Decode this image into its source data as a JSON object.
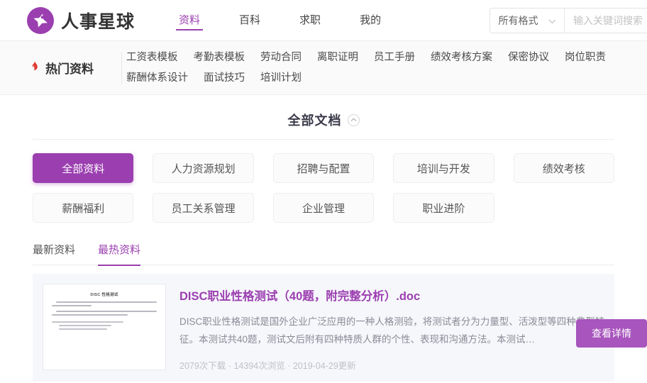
{
  "brand": {
    "name": "人事星球",
    "logo_icon": "star-planet-logo-icon",
    "logo_color": "#9b3fb0"
  },
  "nav": {
    "items": [
      {
        "label": "资料",
        "active": true
      },
      {
        "label": "百科",
        "active": false
      },
      {
        "label": "求职",
        "active": false
      },
      {
        "label": "我的",
        "active": false
      }
    ]
  },
  "search": {
    "format_label": "所有格式",
    "format_icon": "chevron-down-icon",
    "placeholder": "输入关键词搜索",
    "value": ""
  },
  "hot_section": {
    "label": "热门资料",
    "icon": "flame-icon",
    "icon_color": "#e03a2f",
    "tags": [
      "工资表模板",
      "考勤表模板",
      "劳动合同",
      "离职证明",
      "员工手册",
      "绩效考核方案",
      "保密协议",
      "岗位职责",
      "薪酬体系设计",
      "面试技巧",
      "培训计划"
    ]
  },
  "all_docs": {
    "title": "全部文档",
    "collapse_icon": "chevron-up-icon"
  },
  "categories": [
    {
      "label": "全部资料",
      "active": true
    },
    {
      "label": "人力资源规划",
      "active": false
    },
    {
      "label": "招聘与配置",
      "active": false
    },
    {
      "label": "培训与开发",
      "active": false
    },
    {
      "label": "绩效考核",
      "active": false
    },
    {
      "label": "薪酬福利",
      "active": false
    },
    {
      "label": "员工关系管理",
      "active": false
    },
    {
      "label": "企业管理",
      "active": false
    },
    {
      "label": "职业进阶",
      "active": false
    }
  ],
  "sort_tabs": [
    {
      "label": "最新资料",
      "active": false
    },
    {
      "label": "最热资料",
      "active": true
    }
  ],
  "documents": [
    {
      "title": "DISC职业性格测试（40题，附完整分析）.doc",
      "description": "DISC职业性格测试是国外企业广泛应用的一种人格测验，将测试者分为力量型、活泼型等四种典型特征。本测试共40题，测试文后附有四种特质人群的个性、表现和沟通方法。本测试…",
      "downloads": "2079次下载",
      "views": "14394次浏览",
      "updated": "2019-04-29更新",
      "separator": "·",
      "thumbnail_title": "DISC 性格测试",
      "detail_button": "查看详情"
    }
  ],
  "theme": {
    "primary": "#9b3fb0",
    "button_purple": "#a855bd",
    "card_bg": "#f6f7fb"
  }
}
